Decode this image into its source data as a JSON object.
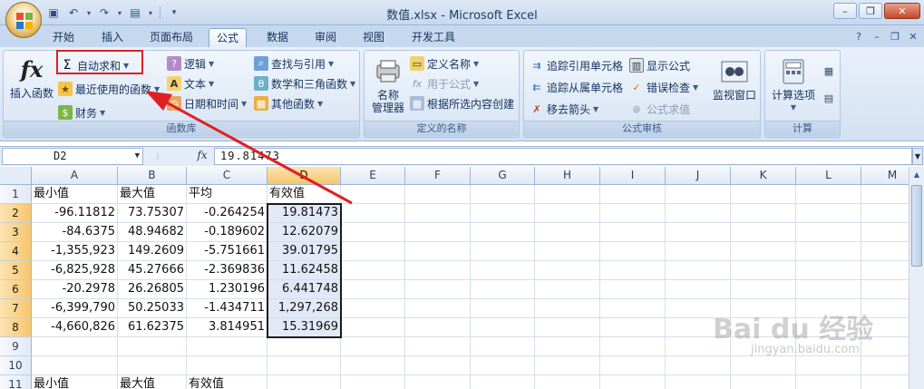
{
  "window": {
    "title": "数值.xlsx - Microsoft Excel"
  },
  "tabs": [
    "开始",
    "插入",
    "页面布局",
    "公式",
    "数据",
    "审阅",
    "视图",
    "开发工具"
  ],
  "active_tab": "公式",
  "ribbon": {
    "function_library": {
      "label": "函数库",
      "insert_function": "插入函数",
      "autosum": "自动求和",
      "recent": "最近使用的函数",
      "financial": "财务",
      "logical": "逻辑",
      "text": "文本",
      "datetime": "日期和时间",
      "lookup": "查找与引用",
      "math": "数学和三角函数",
      "more": "其他函数"
    },
    "defined_names": {
      "label": "定义的名称",
      "name_manager": "名称\n管理器",
      "name_manager_l1": "名称",
      "name_manager_l2": "管理器",
      "define_name": "定义名称",
      "use_in_formula": "用于公式",
      "create_from_sel": "根据所选内容创建"
    },
    "formula_auditing": {
      "label": "公式审核",
      "trace_precedents": "追踪引用单元格",
      "trace_dependents": "追踪从属单元格",
      "remove_arrows": "移去箭头",
      "show_formulas": "显示公式",
      "error_check": "错误检查",
      "evaluate": "公式求值",
      "watch_window": "监视窗口"
    },
    "calculation": {
      "label": "计算",
      "options": "计算选项"
    }
  },
  "formula_bar": {
    "name_box": "D2",
    "value": "19.81473"
  },
  "columns": [
    "A",
    "B",
    "C",
    "D",
    "E",
    "F",
    "G",
    "H",
    "I",
    "J",
    "K",
    "L",
    "M"
  ],
  "rows": [
    "1",
    "2",
    "3",
    "4",
    "5",
    "6",
    "7",
    "8",
    "9",
    "10",
    "11"
  ],
  "cells": {
    "r1": [
      "最小值",
      "最大值",
      "平均",
      "有效值"
    ],
    "r2": [
      "-96.11812",
      "73.75307",
      "-0.264254",
      "19.81473"
    ],
    "r3": [
      "-84.6375",
      "48.94682",
      "-0.189602",
      "12.62079"
    ],
    "r4": [
      "-1,355,923",
      "149.2609",
      "-5.751661",
      "39.01795"
    ],
    "r5": [
      "-6,825,928",
      "45.27666",
      "-2.369836",
      "11.62458"
    ],
    "r6": [
      "-20.2978",
      "26.26805",
      "1.230196",
      "6.441748"
    ],
    "r7": [
      "-6,399,790",
      "50.25033",
      "-1.434711",
      "1,297,268"
    ],
    "r8": [
      "-4,660,826",
      "61.62375",
      "3.814951",
      "15.31969"
    ],
    "r11": [
      "最小值",
      "最大值",
      "有效值"
    ]
  },
  "colors": {
    "selection_fill": "#e3e8f6",
    "annotation": "#e02020",
    "header_selected": "#f7c66e"
  },
  "watermark": {
    "brand": "Bai du 经验",
    "url": "jingyan.baidu.com"
  }
}
